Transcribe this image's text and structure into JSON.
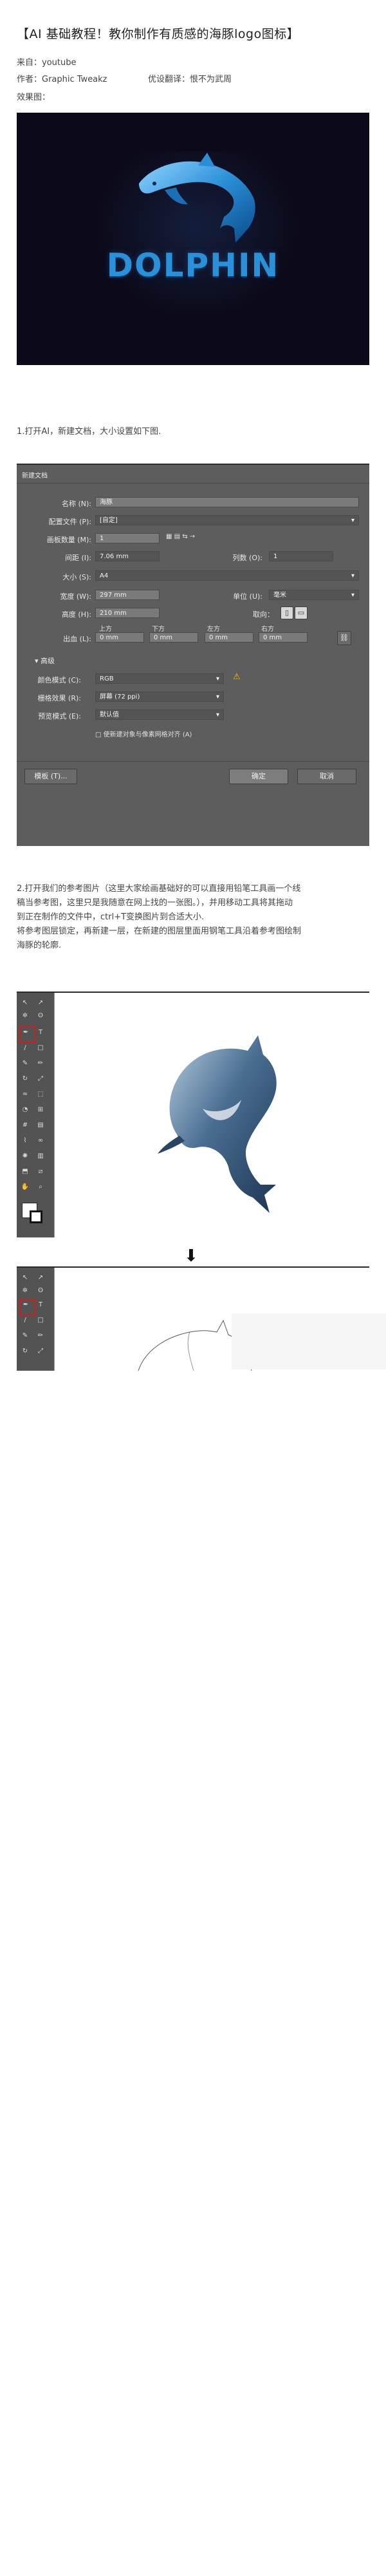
{
  "article": {
    "title": "【AI 基础教程！教你制作有质感的海豚logo图标】",
    "source": "来自：youtube",
    "author": "作者：Graphic Tweakz",
    "translator": "优设翻译：恨不为武周",
    "result_label": "效果图："
  },
  "hero": {
    "logo_text": "DOLPHIN"
  },
  "step1": {
    "text": "1.打开AI，新建文档，大小设置如下图."
  },
  "dialog": {
    "title": "新建文档",
    "name_label": "名称 (N):",
    "name_value": "海豚",
    "profile_label": "配置文件 (P):",
    "profile_value": "[自定]",
    "artboards_label": "画板数量 (M):",
    "artboards_value": "1",
    "spacing_label": "间距 (I):",
    "spacing_value": "7.06 mm",
    "columns_label": "列数 (O):",
    "columns_value": "1",
    "size_label": "大小 (S):",
    "size_value": "A4",
    "width_label": "宽度 (W):",
    "width_value": "297 mm",
    "units_label": "单位 (U):",
    "units_value": "毫米",
    "height_label": "高度 (H):",
    "height_value": "210 mm",
    "orientation_label": "取向：",
    "bleed_top_label": "上方",
    "bleed_bottom_label": "下方",
    "bleed_left_label": "左方",
    "bleed_right_label": "右方",
    "bleed_label": "出血 (L):",
    "bleed_top": "0 mm",
    "bleed_bottom": "0 mm",
    "bleed_left": "0 mm",
    "bleed_right": "0 mm",
    "advanced_label": "高级",
    "color_mode_label": "颜色模式 (C):",
    "color_mode_value": "RGB",
    "raster_label": "栅格效果 (R):",
    "raster_value": "屏幕 (72 ppi)",
    "preview_label": "预览模式 (E):",
    "preview_value": "默认值",
    "pixel_grid_label": "使新建对象与像素网格对齐 (A)",
    "template_button": "模板 (T)...",
    "ok_button": "确定",
    "cancel_button": "取消"
  },
  "step2": {
    "line1": "2.打开我们的参考图片（这里大家绘画基础好的可以直接用铅笔工具画一个线",
    "line2": "稿当参考图，这里只是我随意在网上找的一张图。），并用移动工具将其拖动",
    "line3": "到正在制作的文件中，ctrl+T变换图片到合适大小.",
    "line4": "将参考图层锁定，再新建一层，在新建的图层里面用钢笔工具沿着参考图绘制",
    "line5": "海豚的轮廓."
  },
  "colors": {
    "hero_bg": "#0c0a1a",
    "logo_blue": "#2a90d8",
    "highlight_red": "#d21d1d",
    "dialog_bg": "#5d5d5d"
  },
  "icons": {
    "down_arrow": "⬇"
  }
}
